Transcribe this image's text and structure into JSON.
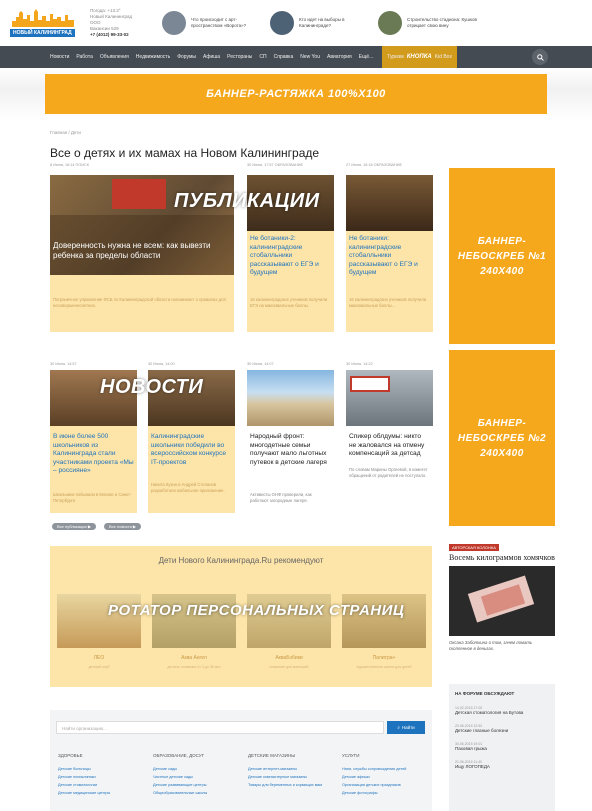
{
  "header": {
    "logo_text": "НОВЫЙ КАЛИНИНГРАД",
    "contacts": [
      "Погода: +13.3°",
      "Новый Калининград",
      "ООО",
      "Вакансии 529"
    ],
    "phone": "+7 (4012) 99-33-02",
    "teasers": [
      {
        "text": "Что происходит с арт-пространством «Ворота»?"
      },
      {
        "text": "Кто идет на выборы в Калининграде?"
      },
      {
        "text": "Строительство стадиона: Кушков отрицает свою вину"
      }
    ]
  },
  "nav": {
    "items": [
      "Новости",
      "Работа",
      "Объявления",
      "Недвижимость",
      "Форумы",
      "Афиша",
      "Рестораны",
      "СП",
      "Справка",
      "New You",
      "Авиатория",
      "Ещё..."
    ],
    "special_left": "Туризм",
    "special_button": "КНОПКА",
    "special_right": "Kid Box"
  },
  "banner_wide": "БАННЕР-РАСТЯЖКА 100%Х100",
  "breadcrumb": "Главная  /  Дети",
  "page_title": "Все о детях и их мамах на Новом Калининграде",
  "overlays": {
    "publications": "ПУБЛИКАЦИИ",
    "news": "НОВОСТИ",
    "rotator": "РОТАТОР ПЕРСОНАЛЬНЫХ СТРАНИЦ"
  },
  "publications": [
    {
      "meta": "8 Июня, 16:14  ПОИСК",
      "title": "Доверенность нужна не всем: как вывезти ребенка за пределы области",
      "excerpt": "Пограничное управление ФСБ по Калининградской области напоминает о правилах для несовершеннолетних."
    },
    {
      "meta": "30 Июня, 17:57  ОБРАЗОВАНИЕ",
      "title": "Не ботаники-2: калининградские стобалльники рассказывают о ЕГЭ и будущем",
      "excerpt": "16 калининградских учеников получили ЕГЭ на максимальные баллы."
    },
    {
      "meta": "27 Июня, 16:18  ОБРАЗОВАНИЕ",
      "title": "Не ботаники: калининградские стобалльники рассказывают о ЕГЭ и будущем",
      "excerpt": "16 калининградских учеников получили максимальные баллы..."
    }
  ],
  "news": [
    {
      "meta": "30 Июня, 14:57",
      "title": "В июне более 500 школьников из Калининграда стали участниками проекта «Мы – россияне»",
      "excerpt": "Школьники побывали в Москве и Санкт-Петербурге."
    },
    {
      "meta": "30 Июня, 14:00",
      "title": "Калининградские школьники победили во всероссийском конкурсе IT-проектов",
      "excerpt": "Никита Кузин и Андрей Степанов разработали мобильное приложение."
    },
    {
      "meta": "30 Июня, 14:07",
      "title": "Народный фронт: многодетные семьи получают мало льготных путевок в детские лагеря",
      "excerpt": "Активисты ОНФ проверили, как работают загородные лагеря."
    },
    {
      "meta": "30 Июня, 14:22",
      "title": "Спикер облдумы: никто не жаловался на отмену компенсаций за детсад",
      "excerpt": "По словам Марины Оргеевой, в комитет обращений от родителей не поступало."
    }
  ],
  "pills": [
    "Все публикации ▶",
    "Все новости ▶"
  ],
  "banner_tall_1": [
    "БАННЕР-",
    "НЕБОСКРЕБ №1",
    "240Х400"
  ],
  "banner_tall_2": [
    "БАННЕР-",
    "НЕБОСКРЕБ №2",
    "240Х400"
  ],
  "recommend": {
    "title": "Дети Нового Калининграда.Ru рекомендуют",
    "items": [
      {
        "name": "ЛЕО",
        "sub": "детский клуб"
      },
      {
        "name": "Аква Ангел",
        "sub": "детское плавание от 3 до 36 мес"
      },
      {
        "name": "АкваБэбики",
        "sub": "плавание для малышей"
      },
      {
        "name": "Палитра+",
        "sub": "художественная школа для детей"
      }
    ]
  },
  "author_column": {
    "tag": "АВТОРСКАЯ КОЛОНКА",
    "title": "Восемь килограммов хомячков",
    "caption": "Оксана Заботкина о том, зачем ломать скопленное в деньгах."
  },
  "forum": {
    "header": "НА ФОРУМЕ ОБСУЖДАЮТ",
    "items": [
      {
        "date": "14.02.2015 17:00",
        "title": "Детская стоматология на Бутова"
      },
      {
        "date": "20.06.2015 12:52",
        "title": "Детские глазные болезни"
      },
      {
        "date": "30.06.2015 19:01",
        "title": "Паховая грыжа"
      },
      {
        "date": "21.06.2015 11:40",
        "title": "Ищу ЛОГОПЕДА"
      }
    ]
  },
  "footer": {
    "search_placeholder": "Найти организацию...",
    "search_button": "Найти",
    "columns": [
      {
        "head": "ЗДОРОВЬЕ",
        "links": [
          "Детские больницы",
          "Детские поликлиники",
          "Детские стоматологии",
          "Детские медицинские центры"
        ]
      },
      {
        "head": "ОБРАЗОВАНИЕ, ДОСУГ",
        "links": [
          "Детские сады",
          "Частные детские сады",
          "Детские развивающие центры",
          "Общеобразовательные школы"
        ]
      },
      {
        "head": "ДЕТСКИЕ МАГАЗИНЫ",
        "links": [
          "Детские интернет-магазины",
          "Детские компьютерные магазины",
          "Товары для беременных и кормящих мам"
        ]
      },
      {
        "head": "УСЛУГИ",
        "links": [
          "Няни, службы сопровождения детей",
          "Детские афиши",
          "Организация детских праздников",
          "Детские фотографы"
        ]
      }
    ]
  },
  "colors": {
    "accent": "#f6a81d",
    "card": "#fde4a8",
    "nav": "#454b52",
    "link": "#1e73be"
  }
}
